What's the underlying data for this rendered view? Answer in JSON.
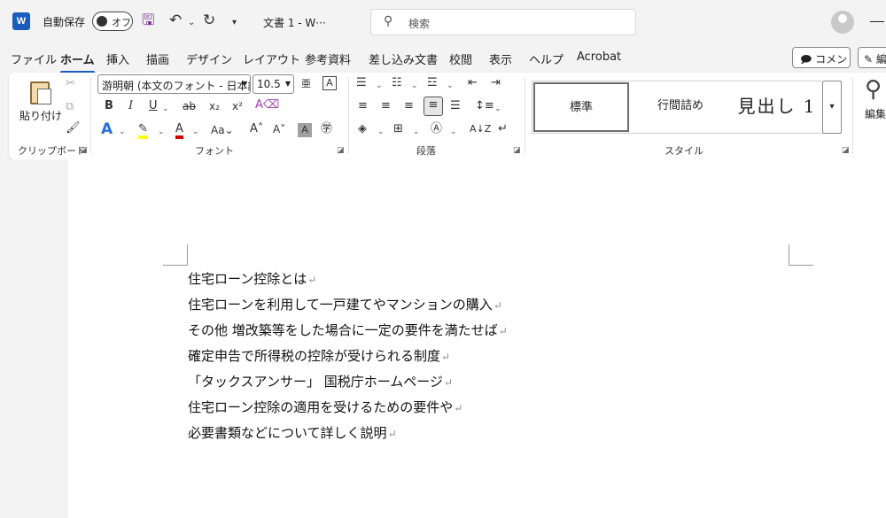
{
  "titlebar": {
    "app_logo": "W",
    "autosave_label": "自動保存",
    "autosave_state": "オフ",
    "doc_title": "文書 1  -  W···",
    "search_placeholder": "検索",
    "icons": [
      "word-logo-icon",
      "save-icon",
      "undo-icon",
      "redo-icon",
      "customize-qat-icon",
      "search-icon",
      "avatar",
      "minimize-icon"
    ]
  },
  "tabs": [
    {
      "label": "ファイル",
      "active": false
    },
    {
      "label": "ホーム",
      "active": true
    },
    {
      "label": "挿入",
      "active": false
    },
    {
      "label": "描画",
      "active": false
    },
    {
      "label": "デザイン",
      "active": false
    },
    {
      "label": "レイアウト",
      "active": false
    },
    {
      "label": "参考資料",
      "active": false
    },
    {
      "label": "差し込み文書",
      "active": false
    },
    {
      "label": "校閲",
      "active": false
    },
    {
      "label": "表示",
      "active": false
    },
    {
      "label": "ヘルプ",
      "active": false
    },
    {
      "label": "Acrobat",
      "active": false
    }
  ],
  "actions": {
    "comment": "コメント",
    "edit": "編集"
  },
  "ribbon": {
    "clipboard": {
      "label": "クリップボード",
      "paste": "貼り付け"
    },
    "font": {
      "label": "フォント",
      "font_name": "游明朝 (本文のフォント - 日本語)",
      "font_size": "10.5"
    },
    "paragraph": {
      "label": "段落"
    },
    "styles": {
      "label": "スタイル",
      "items": [
        "標準",
        "行間詰め",
        "見出し 1"
      ]
    },
    "editing": {
      "label": "編集"
    }
  },
  "document": {
    "paragraphs": [
      "住宅ローン控除とは",
      "住宅ローンを利用して一戸建てやマンションの購入",
      "その他 増改築等をした場合に一定の要件を満たせば",
      "確定申告で所得税の控除が受けられる制度",
      "「タックスアンサー」 国税庁ホームページ",
      "住宅ローン控除の適用を受けるための要件や",
      "必要書類などについて詳しく説明"
    ],
    "paragraph_mark": "↵"
  },
  "colors": {
    "accent": "#1a5dbf",
    "highlight": "#ffff00",
    "font_color": "#d00000"
  }
}
